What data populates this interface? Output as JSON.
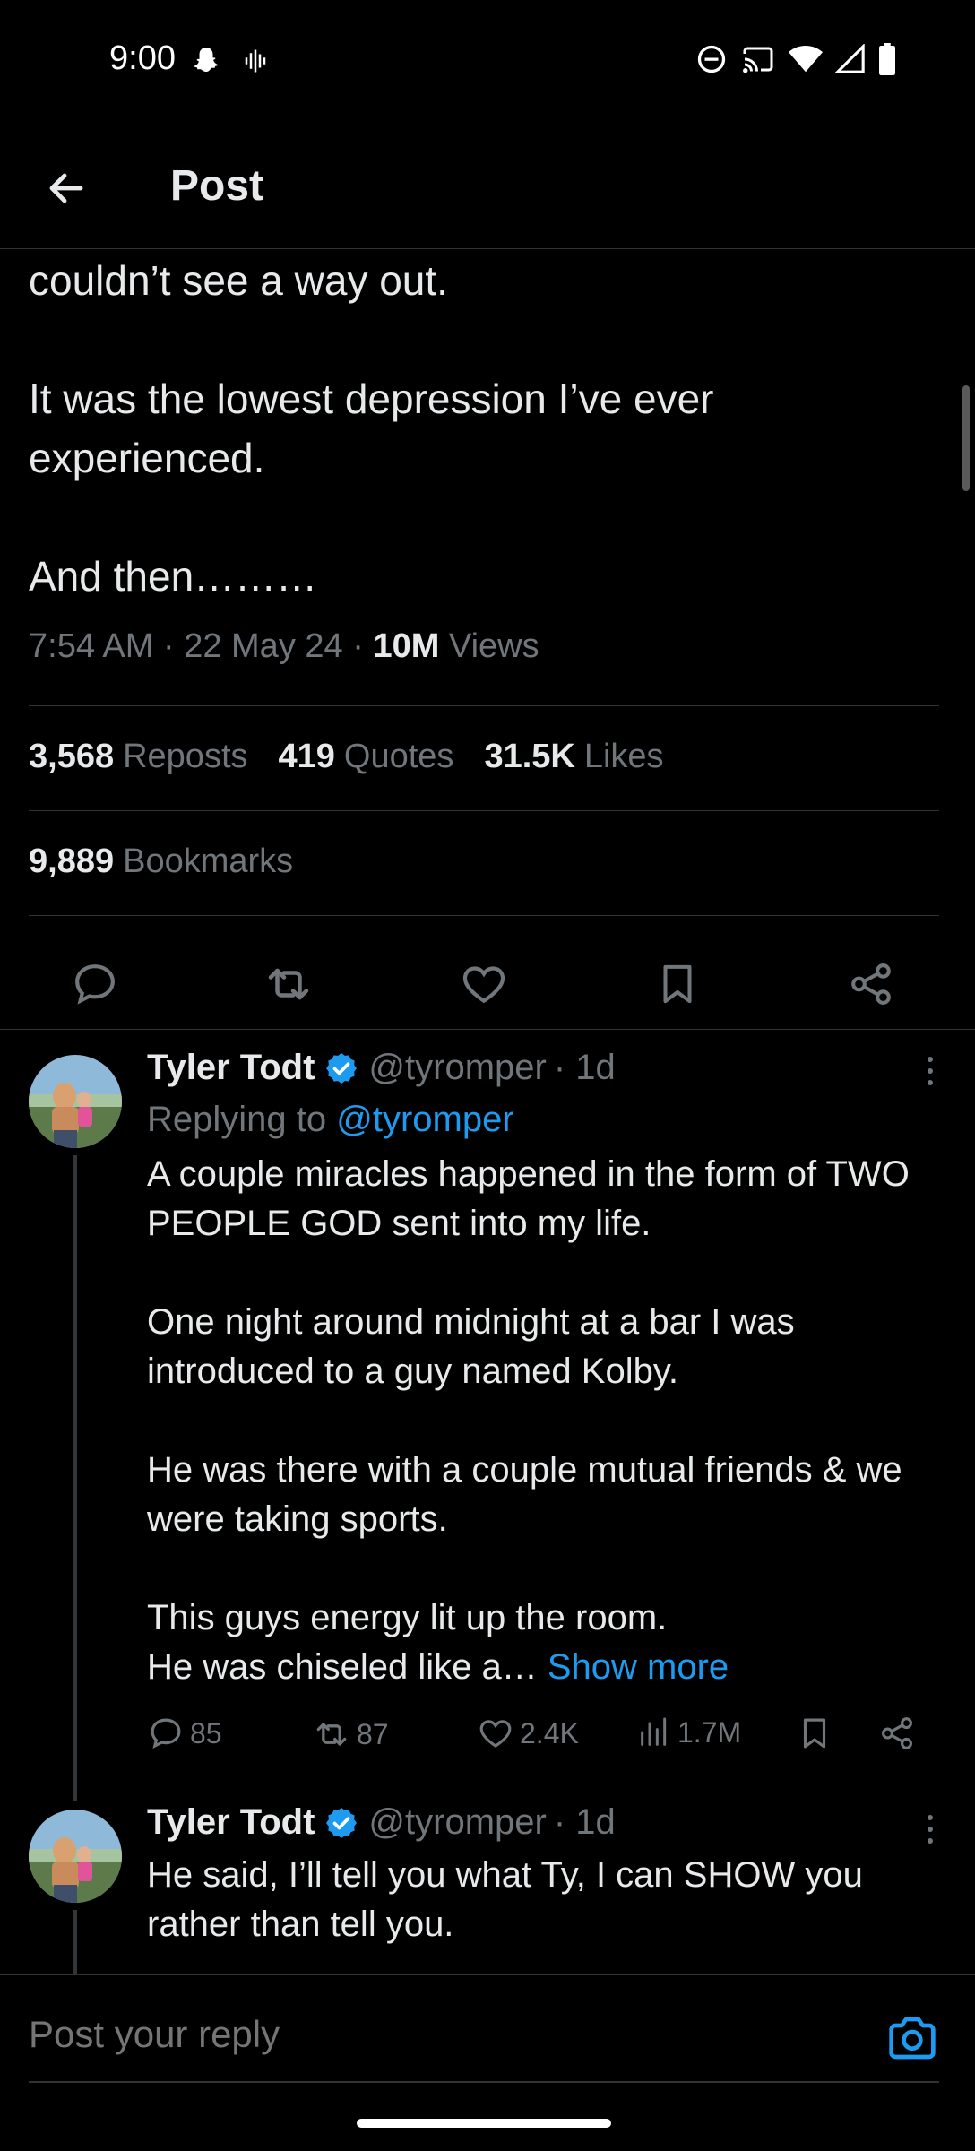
{
  "status_bar": {
    "time": "9:00"
  },
  "header": {
    "title": "Post"
  },
  "tweet": {
    "lines": [
      "couldn’t see a way out.",
      "It was the lowest depression I’ve ever experienced.",
      "And then………"
    ],
    "time": "7:54 AM",
    "date": "22 May 24",
    "views_count": "10M",
    "views_label": "Views",
    "sep": "·"
  },
  "stats": {
    "reposts_count": "3,568",
    "reposts_label": "Reposts",
    "quotes_count": "419",
    "quotes_label": "Quotes",
    "likes_count": "31.5K",
    "likes_label": "Likes",
    "bookmarks_count": "9,889",
    "bookmarks_label": "Bookmarks"
  },
  "replies": [
    {
      "name": "Tyler Todt",
      "handle": "@tyromper",
      "age": "· 1d",
      "replying_label": "Replying to",
      "replying_handle": "@tyromper",
      "paragraphs": [
        "A couple miracles happened in the form of TWO PEOPLE GOD sent into my life.",
        "One night around midnight at a bar I was introduced to a guy named Kolby.",
        "He was there with a couple mutual friends & we were taking sports.",
        "This guys energy lit up the room."
      ],
      "last_line": "He was chiseled like a…",
      "show_more": "Show more",
      "replies_count": "85",
      "reposts_count": "87",
      "likes_count": "2.4K",
      "views_count": "1.7M"
    },
    {
      "name": "Tyler Todt",
      "handle": "@tyromper",
      "age": "· 1d",
      "text": "He said, I’ll tell you what Ty, I can SHOW you rather than tell you."
    }
  ],
  "composer": {
    "placeholder": "Post your reply"
  },
  "colors": {
    "background": "#000000",
    "text": "#e7e9ea",
    "secondary": "#71767b",
    "accent": "#1d9bf0",
    "divider": "#2f3336"
  }
}
